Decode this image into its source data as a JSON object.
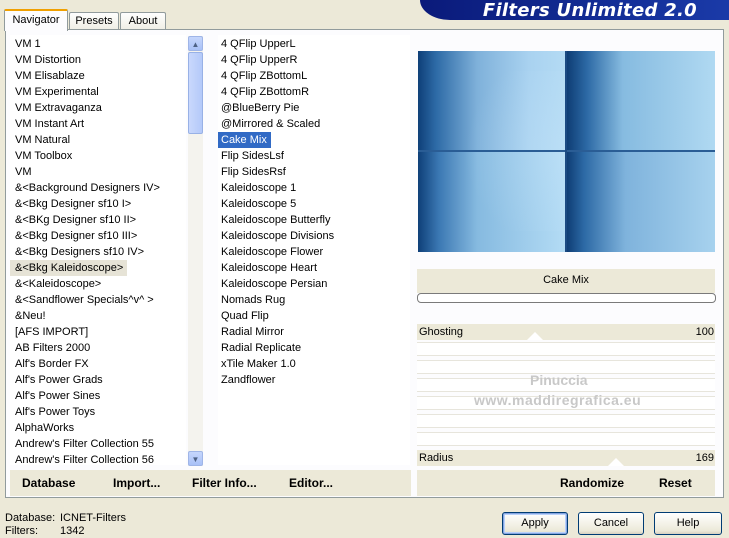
{
  "banner": {
    "title": "Filters Unlimited 2.0"
  },
  "tabs": [
    {
      "label": "Navigator"
    },
    {
      "label": "Presets"
    },
    {
      "label": "About"
    }
  ],
  "categories": [
    "VM 1",
    "VM Distortion",
    "VM Elisablaze",
    "VM Experimental",
    "VM Extravaganza",
    "VM Instant Art",
    "VM Natural",
    "VM Toolbox",
    "VM",
    "&<Background Designers IV>",
    "&<Bkg Designer sf10 I>",
    "&<BKg Designer sf10 II>",
    "&<Bkg Designer sf10 III>",
    "&<Bkg Designers sf10 IV>",
    "&<Bkg Kaleidoscope>",
    "&<Kaleidoscope>",
    "&<Sandflower Specials^v^ >",
    "&Neu!",
    "[AFS IMPORT]",
    "AB Filters 2000",
    "Alf's Border FX",
    "Alf's Power Grads",
    "Alf's Power Sines",
    "Alf's Power Toys",
    "AlphaWorks",
    "Andrew's Filter Collection 55",
    "Andrew's Filter Collection 56"
  ],
  "selected_category": "&<Bkg Kaleidoscope>",
  "filters": [
    "4 QFlip UpperL",
    "4 QFlip UpperR",
    "4 QFlip ZBottomL",
    "4 QFlip ZBottomR",
    "@BlueBerry Pie",
    "@Mirrored & Scaled",
    "Cake Mix",
    "Flip SidesLsf",
    "Flip SidesRsf",
    "Kaleidoscope 1",
    "Kaleidoscope 5",
    "Kaleidoscope Butterfly",
    "Kaleidoscope Divisions",
    "Kaleidoscope Flower",
    "Kaleidoscope Heart",
    "Kaleidoscope Persian",
    "Nomads Rug",
    "Quad Flip",
    "Radial Mirror",
    "Radial Replicate",
    "xTile Maker 1.0",
    "Zandflower"
  ],
  "selected_filter": "Cake Mix",
  "preview_label": "Cake Mix",
  "params": [
    {
      "label": "Ghosting",
      "value": "100",
      "level": 1.0
    },
    {
      "label": "Radius",
      "value": "169",
      "level": 0.66
    }
  ],
  "watermark": {
    "line1": "Pinuccia",
    "line2": "www.maddiregrafica.eu"
  },
  "bottom_bar": {
    "database": "Database",
    "import": "Import...",
    "filter_info": "Filter Info...",
    "editor": "Editor...",
    "randomize": "Randomize",
    "reset": "Reset"
  },
  "status": {
    "database_label": "Database:",
    "database_value": "ICNET-Filters",
    "filters_label": "Filters:",
    "filters_value": "1342"
  },
  "buttons": {
    "apply": "Apply",
    "cancel": "Cancel",
    "help": "Help"
  },
  "colors": {
    "selection_blue": "#316ac5",
    "banner_navy": "#0a1a7a",
    "tab_accent": "#f0a000"
  }
}
